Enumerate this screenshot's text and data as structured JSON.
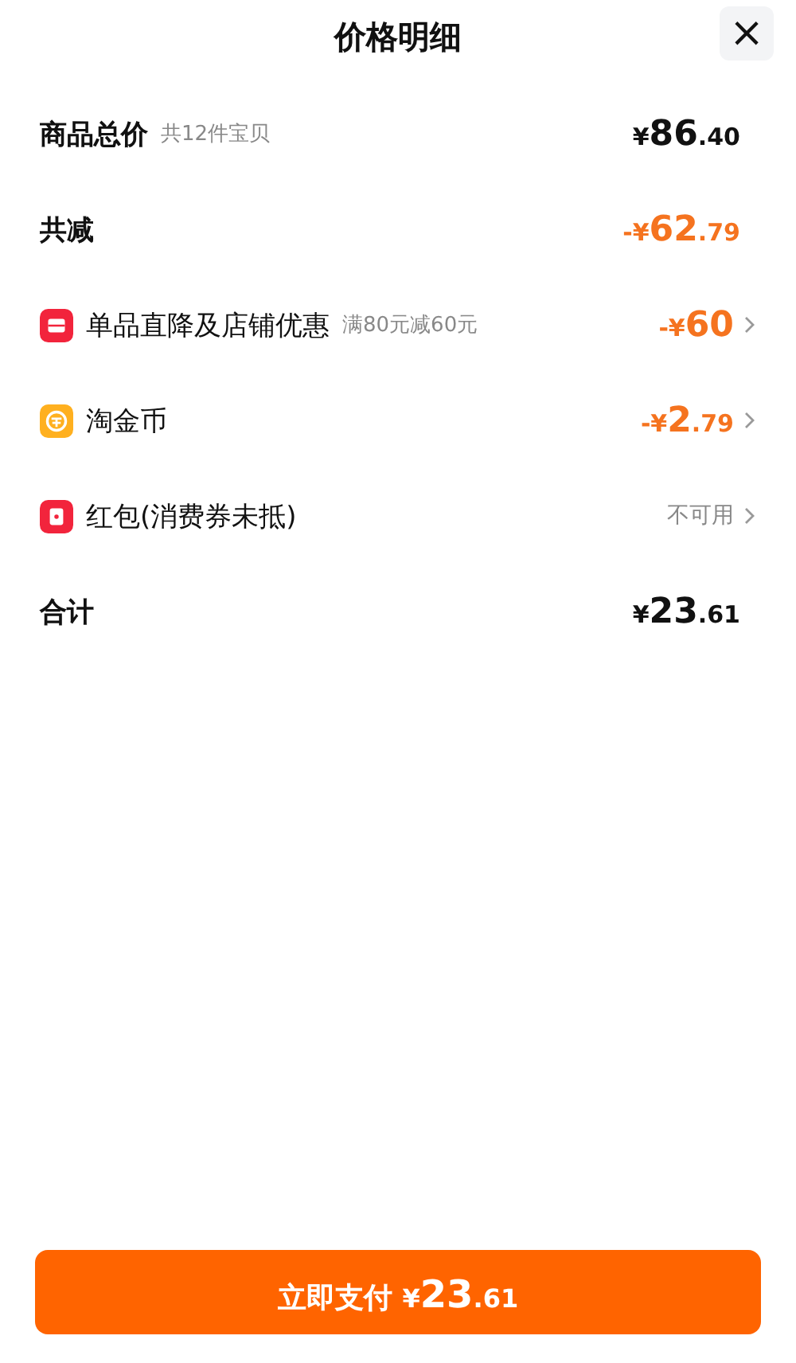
{
  "header": {
    "title": "价格明细",
    "close": "×"
  },
  "rows": [
    {
      "kind": "summary",
      "label": "商品总价",
      "note": "共12件宝贝",
      "amount": {
        "currency": "¥",
        "main": "86",
        "fraction": ".40"
      },
      "accent": false,
      "chevron": false
    },
    {
      "kind": "summary",
      "label": "共减",
      "amount": {
        "sign": "-",
        "currency": "¥",
        "main": "62",
        "fraction": ".79"
      },
      "accent": true,
      "chevron": false
    },
    {
      "kind": "detail",
      "label": "单品直降及店铺优惠",
      "note": "满80元减60元",
      "color": "#f2243c",
      "amount": {
        "sign": "-",
        "currency": "¥",
        "main": "60"
      },
      "accent": true,
      "chevron": true
    },
    {
      "kind": "detail",
      "label": "淘金币",
      "color": "#ffb01f",
      "amount": {
        "sign": "-",
        "currency": "¥",
        "main": "2",
        "fraction": ".79"
      },
      "accent": true,
      "chevron": true
    },
    {
      "kind": "detail",
      "label": "红包(消费券未抵)",
      "color": "#f2243c",
      "status": "不可用",
      "chevron": true
    },
    {
      "kind": "summary",
      "label": "合计",
      "amount": {
        "currency": "¥",
        "main": "23",
        "fraction": ".61"
      },
      "accent": false,
      "chevron": false
    }
  ],
  "pay_button": {
    "label": "立即支付",
    "amount": {
      "currency": "¥",
      "main": "23",
      "fraction": ".61"
    }
  }
}
